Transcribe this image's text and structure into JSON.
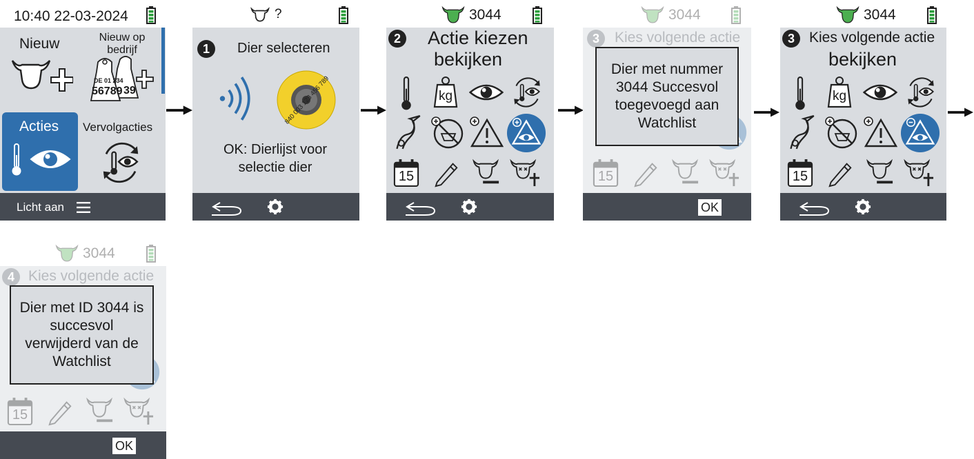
{
  "screen1": {
    "status_time": "10:40 22-03-2024",
    "tile_new": "Nieuw",
    "tile_new_company": "Nieuw op bedrijf",
    "tag_line1": "DE 01 234",
    "tag_line2": "56789",
    "tag_partial": "39",
    "tile_actions": "Acties",
    "tile_followup": "Vervolgacties",
    "bottom_label": "Licht aan"
  },
  "screen2": {
    "status_animal": "?",
    "step": "1",
    "title": "Dier selecteren",
    "tag_number": "840 003 123 456 789",
    "hint": "OK: Dierlijst voor selectie dier"
  },
  "screen3": {
    "status_animal": "3044",
    "step": "2",
    "title": "Actie kiezen",
    "subtitle": "bekijken",
    "kg_label": "kg",
    "calendar_day": "15"
  },
  "screen4": {
    "status_animal": "3044",
    "step": "3",
    "title": "Kies volgende actie",
    "dialog_text": "Dier met nummer 3044 Succesvol toegevoegd aan Watchlist",
    "ok_label": "OK",
    "calendar_day": "15"
  },
  "screen5": {
    "status_animal": "3044",
    "step": "3",
    "title": "Kies volgende actie",
    "subtitle": "bekijken",
    "kg_label": "kg",
    "calendar_day": "15"
  },
  "screen6": {
    "status_animal": "3044",
    "step": "4",
    "title": "Kies volgende actie",
    "dialog_text": "Dier met ID 3044 is succesvol verwijderd van de Watchlist",
    "ok_label": "OK",
    "calendar_day": "15"
  },
  "colors": {
    "screen_bg": "#d9dce0",
    "bottom_bar": "#454a52",
    "accent_blue": "#2f6fad",
    "battery_green": "#2a9d3a",
    "cow_green": "#4caf50",
    "tag_yellow": "#f2d02b"
  }
}
